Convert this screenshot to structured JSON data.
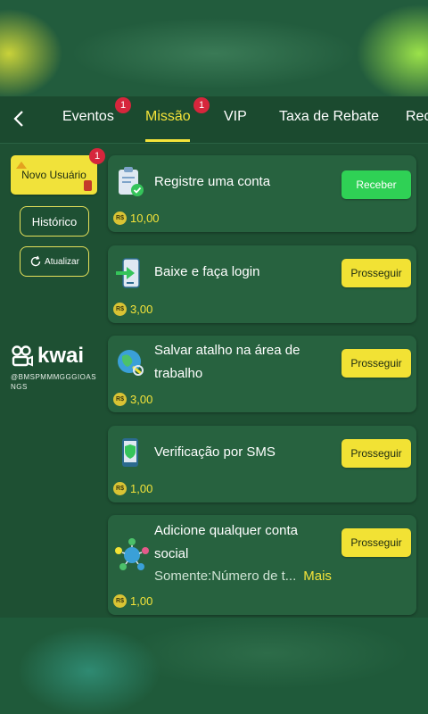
{
  "tabs": [
    {
      "label": "Eventos",
      "badge": "1"
    },
    {
      "label": "Missão",
      "badge": "1",
      "active": true
    },
    {
      "label": "VIP"
    },
    {
      "label": "Taxa de Rebate"
    },
    {
      "label": "Rec"
    }
  ],
  "sidebar": {
    "new_user": {
      "label": "Novo Usuário",
      "badge": "1"
    },
    "history_label": "Histórico",
    "refresh_label": "Atualizar"
  },
  "watermark": {
    "brand": "kwai",
    "handle_line1": "@BMSPMMMGGGIOAS",
    "handle_line2": "NGS"
  },
  "currency_symbol": "R$",
  "tasks": [
    {
      "title": "Registre uma conta",
      "reward": "10,00",
      "button": "Receber",
      "icon": "clipboard-check-icon"
    },
    {
      "title": "Baixe e faça login",
      "reward": "3,00",
      "button": "Prosseguir",
      "icon": "phone-download-icon"
    },
    {
      "title_line1": "Salvar atalho na área de",
      "title_line2": "trabalho",
      "reward": "3,00",
      "button": "Prosseguir",
      "icon": "globe-shortcut-icon"
    },
    {
      "title": "Verificação por SMS",
      "reward": "1,00",
      "button": "Prosseguir",
      "icon": "phone-shield-icon"
    },
    {
      "title_line1": "Adicione qualquer conta",
      "title_line2": "social",
      "subtitle": "Somente:Número de t...",
      "more": "Mais",
      "reward": "1,00",
      "button": "Prosseguir",
      "icon": "social-network-icon"
    }
  ],
  "colors": {
    "accent_yellow": "#f4e33a",
    "button_green": "#2fd155",
    "badge_red": "#d6263c",
    "panel_green": "#1e5033",
    "card_green": "#27623f"
  }
}
